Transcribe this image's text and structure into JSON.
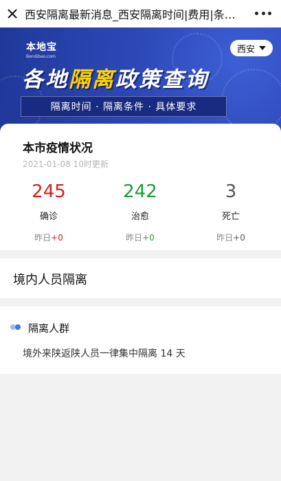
{
  "topbar": {
    "title": "西安隔离最新消息_西安隔离时间|费用|条件|政策"
  },
  "banner": {
    "logo_cn": "本地宝",
    "logo_en": "Bendibao.com",
    "city": "西安",
    "headline_a": "各地",
    "headline_b": "隔离",
    "headline_c": "政策查询",
    "subtitle": "隔离时间 · 隔离条件 · 具体要求"
  },
  "status": {
    "title": "本市疫情状况",
    "updated": "2021-01-08 10时更新",
    "items": [
      {
        "value": "245",
        "label": "确诊",
        "yesterday_label": "昨日",
        "yesterday_delta": "+0",
        "color": "#d0211c"
      },
      {
        "value": "242",
        "label": "治愈",
        "yesterday_label": "昨日",
        "yesterday_delta": "+0",
        "color": "#1c9a3a"
      },
      {
        "value": "3",
        "label": "死亡",
        "yesterday_label": "昨日",
        "yesterday_delta": "+0",
        "color": "#555555"
      }
    ]
  },
  "domestic": {
    "title": "境内人员隔离"
  },
  "group": {
    "title": "隔离人群",
    "text": "境外来陕返陕人员一律集中隔离 14 天"
  }
}
